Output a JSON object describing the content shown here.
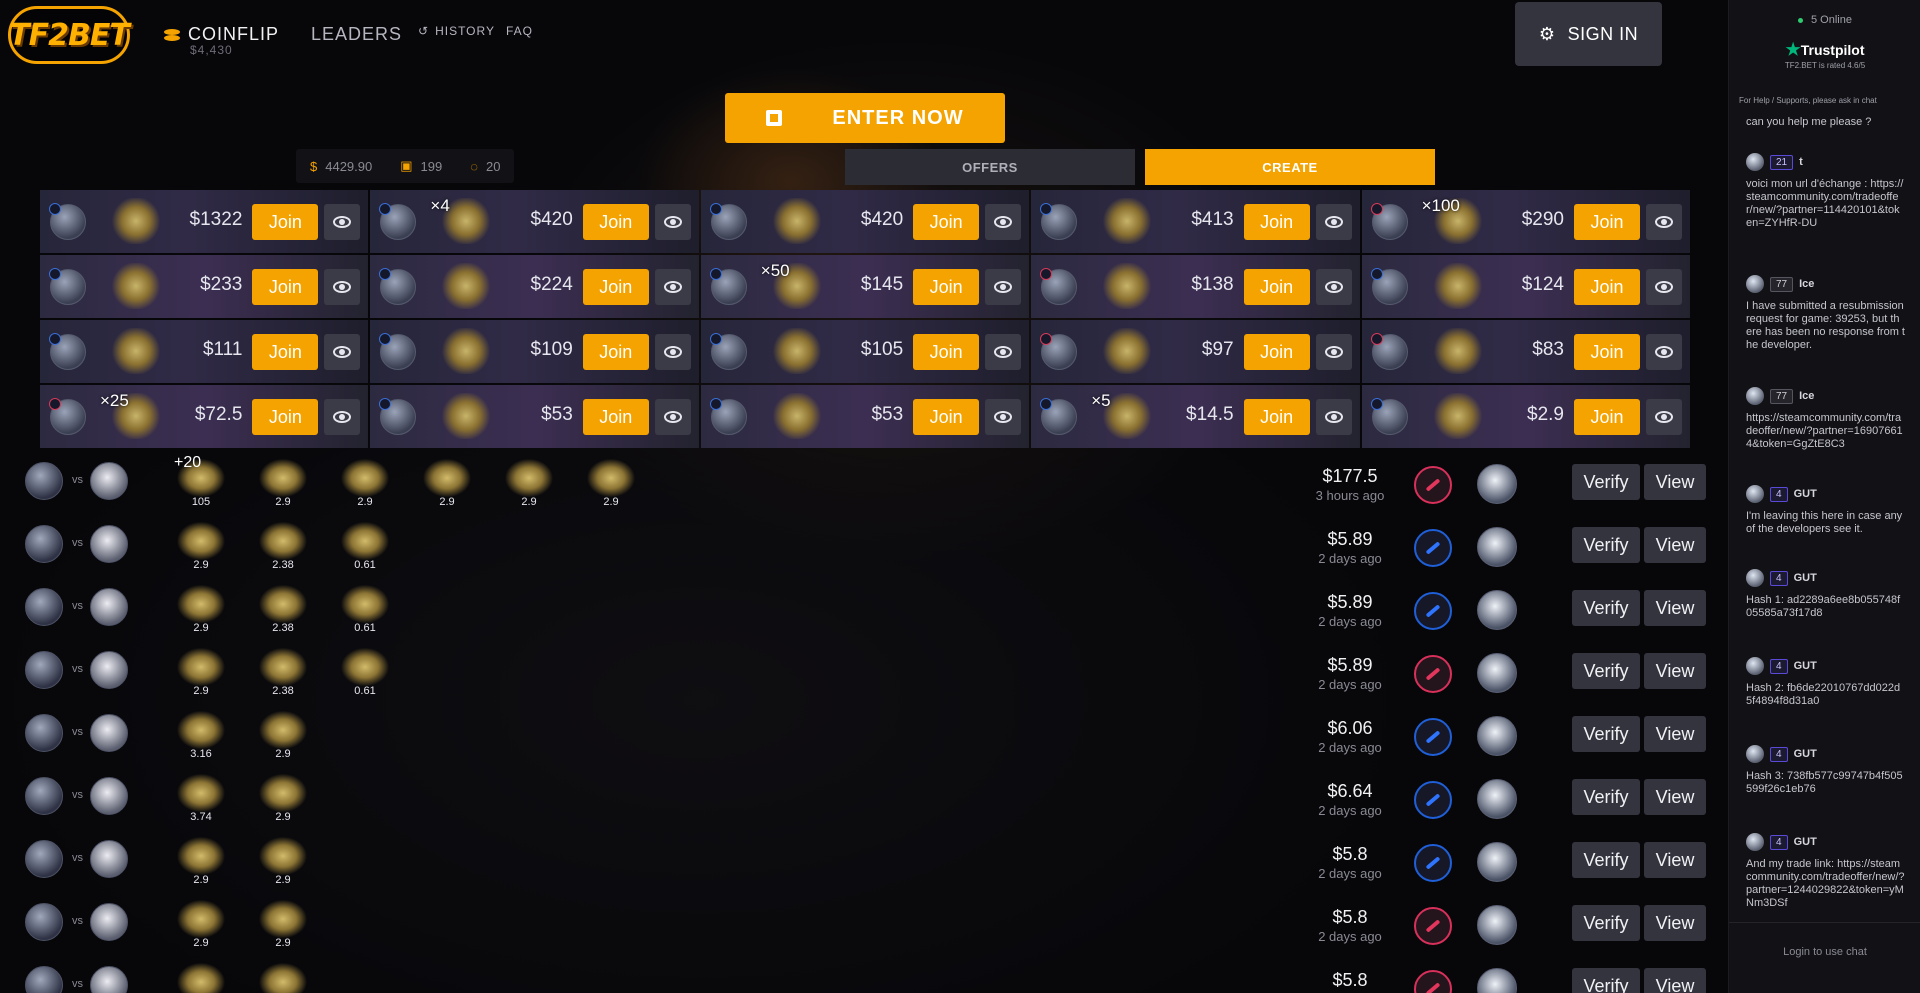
{
  "header": {
    "logo": "TF2BET",
    "coinflip_label": "COINFLIP",
    "coinflip_total": "$4,430",
    "leaders_label": "LEADERS",
    "history_label": "HISTORY",
    "faq_label": "FAQ",
    "signin_label": "SIGN IN"
  },
  "enter_now_label": "ENTER NOW",
  "stats": {
    "total": "4429.90",
    "items": "199",
    "games": "20"
  },
  "tabs": {
    "offers": "OFFERS",
    "create": "CREATE"
  },
  "join_label": "Join",
  "offers": [
    {
      "price": "$1322",
      "qty": "",
      "side": "blue"
    },
    {
      "price": "$420",
      "qty": "×4",
      "side": "blue"
    },
    {
      "price": "$420",
      "qty": "",
      "side": "blue"
    },
    {
      "price": "$413",
      "qty": "",
      "side": "blue"
    },
    {
      "price": "$290",
      "qty": "×100",
      "side": "red"
    },
    {
      "price": "$233",
      "qty": "",
      "side": "blue"
    },
    {
      "price": "$224",
      "qty": "",
      "side": "blue"
    },
    {
      "price": "$145",
      "qty": "×50",
      "side": "blue"
    },
    {
      "price": "$138",
      "qty": "",
      "side": "red"
    },
    {
      "price": "$124",
      "qty": "",
      "side": "blue"
    },
    {
      "price": "$111",
      "qty": "",
      "side": "blue"
    },
    {
      "price": "$109",
      "qty": "",
      "side": "blue"
    },
    {
      "price": "$105",
      "qty": "",
      "side": "blue"
    },
    {
      "price": "$97",
      "qty": "",
      "side": "red"
    },
    {
      "price": "$83",
      "qty": "",
      "side": "red"
    },
    {
      "price": "$72.5",
      "qty": "×25",
      "side": "red"
    },
    {
      "price": "$53",
      "qty": "",
      "side": "blue"
    },
    {
      "price": "$53",
      "qty": "",
      "side": "blue"
    },
    {
      "price": "$14.5",
      "qty": "×5",
      "side": "blue"
    },
    {
      "price": "$2.9",
      "qty": "",
      "side": "blue"
    }
  ],
  "history": {
    "vs_label": "vs",
    "verify_label": "Verify",
    "view_label": "View",
    "rows": [
      {
        "price": "$177.5",
        "time": "3 hours ago",
        "side": "red",
        "items": [
          {
            "q": "+20",
            "v": "105"
          },
          {
            "q": "",
            "v": "2.9"
          },
          {
            "q": "",
            "v": "2.9"
          },
          {
            "q": "",
            "v": "2.9"
          },
          {
            "q": "",
            "v": "2.9"
          },
          {
            "q": "",
            "v": "2.9"
          }
        ]
      },
      {
        "price": "$5.89",
        "time": "2 days ago",
        "side": "blue",
        "items": [
          {
            "q": "",
            "v": "2.9"
          },
          {
            "q": "",
            "v": "2.38"
          },
          {
            "q": "",
            "v": "0.61"
          }
        ]
      },
      {
        "price": "$5.89",
        "time": "2 days ago",
        "side": "blue",
        "items": [
          {
            "q": "",
            "v": "2.9"
          },
          {
            "q": "",
            "v": "2.38"
          },
          {
            "q": "",
            "v": "0.61"
          }
        ]
      },
      {
        "price": "$5.89",
        "time": "2 days ago",
        "side": "red",
        "items": [
          {
            "q": "",
            "v": "2.9"
          },
          {
            "q": "",
            "v": "2.38"
          },
          {
            "q": "",
            "v": "0.61"
          }
        ]
      },
      {
        "price": "$6.06",
        "time": "2 days ago",
        "side": "blue",
        "items": [
          {
            "q": "",
            "v": "3.16"
          },
          {
            "q": "",
            "v": "2.9"
          }
        ]
      },
      {
        "price": "$6.64",
        "time": "2 days ago",
        "side": "blue",
        "items": [
          {
            "q": "",
            "v": "3.74"
          },
          {
            "q": "",
            "v": "2.9"
          }
        ]
      },
      {
        "price": "$5.8",
        "time": "2 days ago",
        "side": "blue",
        "items": [
          {
            "q": "",
            "v": "2.9"
          },
          {
            "q": "",
            "v": "2.9"
          }
        ]
      },
      {
        "price": "$5.8",
        "time": "2 days ago",
        "side": "red",
        "items": [
          {
            "q": "",
            "v": "2.9"
          },
          {
            "q": "",
            "v": "2.9"
          }
        ]
      },
      {
        "price": "$5.8",
        "time": "",
        "side": "red",
        "items": [
          {
            "q": "",
            "v": ""
          },
          {
            "q": "",
            "v": ""
          }
        ]
      }
    ]
  },
  "chat": {
    "online": "5 Online",
    "trustpilot": "Trustpilot",
    "trustpilot_sub": "TF2.BET is rated 4.6/5",
    "help": "For Help / Supports, please ask in chat",
    "login": "Login to use chat",
    "messages": [
      {
        "level": "",
        "name": "",
        "text": "can you help me please ?"
      },
      {
        "level": "21",
        "name": "t",
        "text": "voici mon url d'échange : https://steamcommunity.com/tradeoffer/new/?partner=114420101&token=ZYHfR-DU"
      },
      {
        "level": "77",
        "name": "Ice",
        "text": "I have submitted a resubmission request for game: 39253, but there has been no response from the developer."
      },
      {
        "level": "77",
        "name": "Ice",
        "text": "https://steamcommunity.com/tradeoffer/new/?partner=169076614&token=GgZtE8C3"
      },
      {
        "level": "4",
        "name": "GUT",
        "text": "I'm leaving this here in case any of the developers see it."
      },
      {
        "level": "4",
        "name": "GUT",
        "text": "Hash 1: ad2289a6ee8b055748f05585a73f17d8"
      },
      {
        "level": "4",
        "name": "GUT",
        "text": "Hash 2: fb6de22010767dd022d5f4894f8d31a0"
      },
      {
        "level": "4",
        "name": "GUT",
        "text": "Hash 3: 738fb577c99747b4f505599f26c1eb76"
      },
      {
        "level": "4",
        "name": "GUT",
        "text": "And my trade link: https://steamcommunity.com/tradeoffer/new/?partner=1244029822&token=yMNm3DSf"
      }
    ]
  },
  "colors": {
    "accent": "#f5a300",
    "blue_side": "#1f5fd8",
    "red_side": "#d8305a"
  }
}
